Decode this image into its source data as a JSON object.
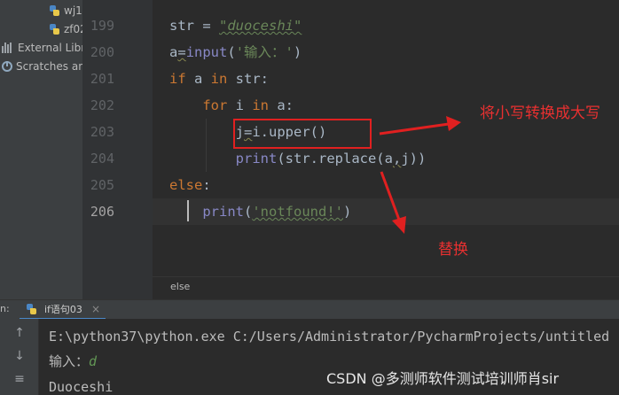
{
  "project_tree": {
    "items": [
      {
        "label": "wj1",
        "icon": "python-file-icon"
      },
      {
        "label": "zf02",
        "icon": "python-file-icon"
      },
      {
        "label": "External Libra",
        "icon": "library-icon"
      },
      {
        "label": "Scratches an",
        "icon": "scratches-icon"
      }
    ]
  },
  "editor": {
    "line_numbers": [
      "199",
      "200",
      "201",
      "202",
      "203",
      "204",
      "205",
      "206"
    ],
    "current_line": "206",
    "lines": [
      [
        {
          "t": "str = "
        },
        {
          "t": "\"duoceshi\"",
          "c": "str-it typo"
        }
      ],
      [
        {
          "t": "a"
        },
        {
          "t": "=",
          "c": "warn-ul"
        },
        {
          "t": "input",
          "c": "fn"
        },
        {
          "t": "("
        },
        {
          "t": "'输入：'",
          "c": "str"
        },
        {
          "t": ")"
        }
      ],
      [
        {
          "t": "if",
          "c": "kw"
        },
        {
          "t": " a "
        },
        {
          "t": "in",
          "c": "kw"
        },
        {
          "t": " str:"
        }
      ],
      [
        {
          "t": "    "
        },
        {
          "t": "for",
          "c": "kw"
        },
        {
          "t": " i "
        },
        {
          "t": "in",
          "c": "kw"
        },
        {
          "t": " a:"
        }
      ],
      [
        {
          "t": "        j"
        },
        {
          "t": "=",
          "c": "warn-ul"
        },
        {
          "t": "i.upper()"
        }
      ],
      [
        {
          "t": "        "
        },
        {
          "t": "print",
          "c": "fn"
        },
        {
          "t": "(str.replace(a"
        },
        {
          "t": ",",
          "c": "warn-ul"
        },
        {
          "t": "j))"
        }
      ],
      [
        {
          "t": "else",
          "c": "kw"
        },
        {
          "t": ":"
        }
      ],
      [
        {
          "t": "    "
        },
        {
          "t": "print",
          "c": "fn"
        },
        {
          "t": "("
        },
        {
          "t": "'notfound!'",
          "c": "str typo"
        },
        {
          "t": ")"
        }
      ]
    ],
    "breadcrumb": "else"
  },
  "run_panel": {
    "label": "n:",
    "tab_label": "if语句03",
    "tab_close": "×",
    "console_lines": [
      {
        "text": "E:\\python37\\python.exe C:/Users/Administrator/PycharmProjects/untitled"
      },
      {
        "prompt": "输入：",
        "input": "d"
      },
      {
        "text": "Duoceshi"
      }
    ]
  },
  "annotations": {
    "upper_note": "将小写转换成大写",
    "replace_note": "替换",
    "color": "#e02020"
  },
  "watermark": "CSDN @多测师软件测试培训师肖sir",
  "colors": {
    "keyword": "#cc7832",
    "string": "#6a8759",
    "builtin": "#8888c6",
    "default_text": "#a9b7c6",
    "background": "#2b2b2b"
  }
}
